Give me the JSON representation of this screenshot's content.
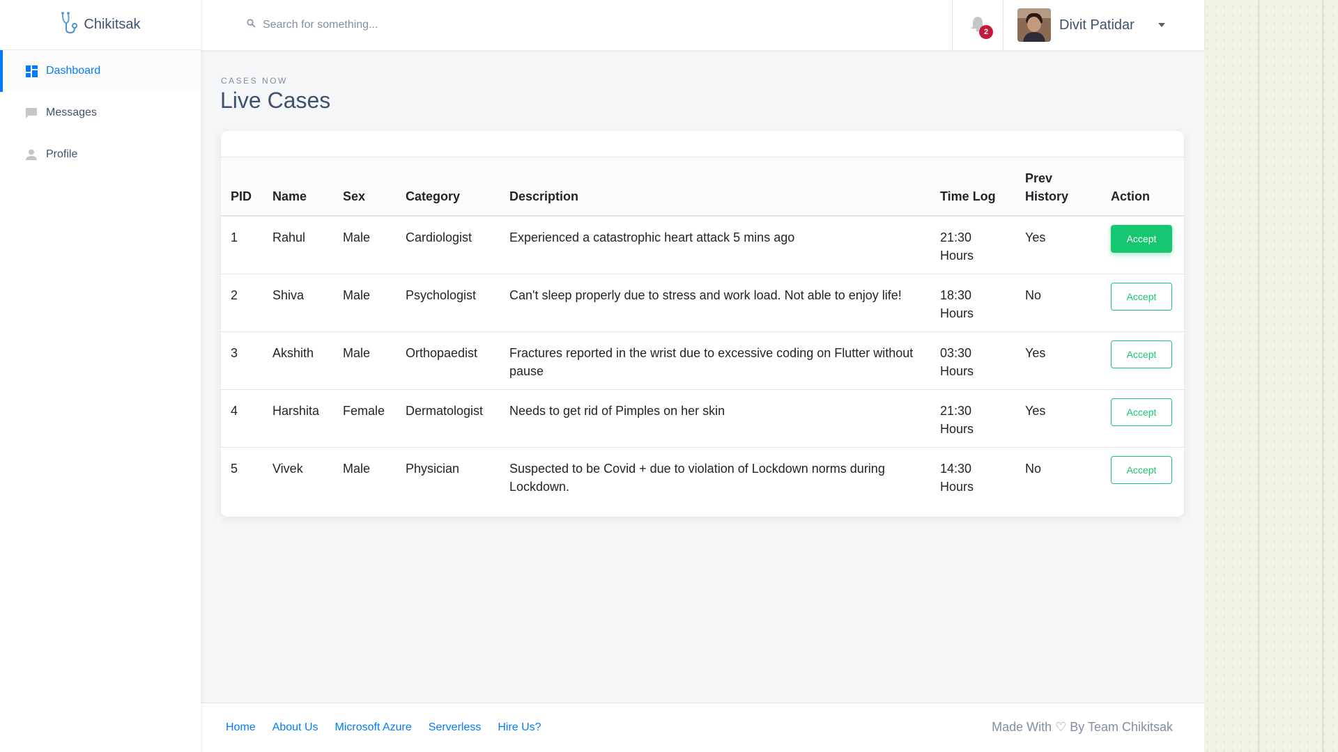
{
  "brand": {
    "name": "Chikitsak",
    "icon": "stethoscope-icon"
  },
  "sidebar": {
    "items": [
      {
        "label": "Dashboard",
        "icon": "dashboard-icon",
        "active": true
      },
      {
        "label": "Messages",
        "icon": "chat-icon",
        "active": false
      },
      {
        "label": "Profile",
        "icon": "person-icon",
        "active": false
      }
    ]
  },
  "search": {
    "placeholder": "Search for something...",
    "value": ""
  },
  "notifications": {
    "count": "2"
  },
  "user": {
    "name": "Divit Patidar"
  },
  "page": {
    "subtitle": "CASES NOW",
    "title": "Live Cases"
  },
  "table": {
    "headers": [
      "PID",
      "Name",
      "Sex",
      "Category",
      "Description",
      "Time Log",
      "Prev History",
      "Action"
    ],
    "rows": [
      {
        "pid": "1",
        "name": "Rahul",
        "sex": "Male",
        "category": "Cardiologist",
        "description": "Experienced a catastrophic heart attack 5 mins ago",
        "time": "21:30 Hours",
        "history": "Yes",
        "action": "Accept"
      },
      {
        "pid": "2",
        "name": "Shiva",
        "sex": "Male",
        "category": "Psychologist",
        "description": "Can't sleep properly due to stress and work load. Not able to enjoy life!",
        "time": "18:30 Hours",
        "history": "No",
        "action": "Accept"
      },
      {
        "pid": "3",
        "name": "Akshith",
        "sex": "Male",
        "category": "Orthopaedist",
        "description": "Fractures reported in the wrist due to excessive coding on Flutter without pause",
        "time": "03:30 Hours",
        "history": "Yes",
        "action": "Accept"
      },
      {
        "pid": "4",
        "name": "Harshita",
        "sex": "Female",
        "category": "Dermatologist",
        "description": "Needs to get rid of Pimples on her skin",
        "time": "21:30 Hours",
        "history": "Yes",
        "action": "Accept"
      },
      {
        "pid": "5",
        "name": "Vivek",
        "sex": "Male",
        "category": "Physician",
        "description": "Suspected to be Covid + due to violation of Lockdown norms during Lockdown.",
        "time": "14:30 Hours",
        "history": "No",
        "action": "Accept"
      }
    ]
  },
  "footer": {
    "links": [
      "Home",
      "About Us",
      "Microsoft Azure",
      "Serverless",
      "Hire Us?"
    ],
    "credit": "Made With ♡ By Team Chikitsak"
  },
  "colors": {
    "accent": "#007bff",
    "success": "#17c671",
    "badge": "#c4183c",
    "text": "#3d5170"
  }
}
